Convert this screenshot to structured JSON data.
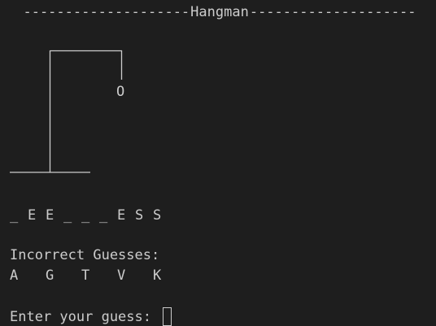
{
  "game": {
    "title": "Hangman",
    "title_dashes_left": "--------------------",
    "title_dashes_right": "--------------------",
    "head_char": "O",
    "word_display": [
      "_",
      "E",
      "E",
      "_",
      "_",
      "_",
      "E",
      "S",
      "S"
    ],
    "incorrect_label": "Incorrect Guesses:",
    "incorrect_guesses": [
      "A",
      "G",
      "T",
      "V",
      "K"
    ],
    "prompt": "Enter your guess: ",
    "input_value": ""
  },
  "colors": {
    "background": "#1e1e1e",
    "text": "#cccccc"
  }
}
